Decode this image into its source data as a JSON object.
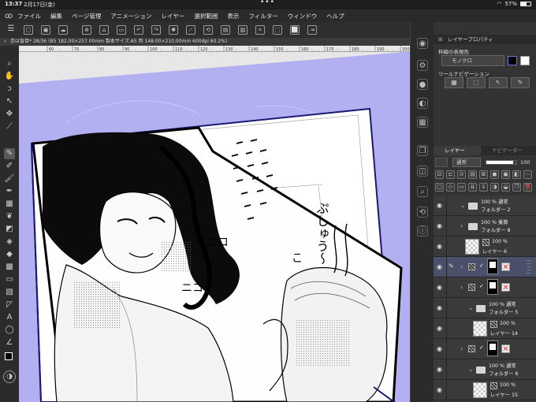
{
  "status": {
    "time": "13:37",
    "date": "2月17日(金)",
    "battery": "57%",
    "battery_level": 0.57
  },
  "menu": {
    "items": [
      "ファイル",
      "編集",
      "ページ管理",
      "アニメーション",
      "レイヤー",
      "選択範囲",
      "表示",
      "フィルター",
      "ウィンドウ",
      "ヘルプ"
    ]
  },
  "document": {
    "tab_title": "恋は盲目* 28/36 (B5 182.00×257.00mm 製本サイズ:A5 判 148.00×210.00mm 600dpi 60.2%)"
  },
  "ruler": {
    "ticks": [
      "60",
      "70",
      "80",
      "90",
      "100",
      "110",
      "120",
      "130",
      "140",
      "150",
      "160",
      "170",
      "180",
      "190",
      "200"
    ]
  },
  "properties": {
    "title": "レイヤープロパティ",
    "effect_label": "枠線の表現色",
    "color_mode": "モノクロ",
    "tool_nav_label": "ツールナビゲーション"
  },
  "layers_panel": {
    "tab_layers": "レイヤー",
    "tab_navigator": "ナビゲーター",
    "blend_mode": "通常",
    "opacity": "100",
    "layers": [
      {
        "line1": "100 % 通常",
        "line2": "フォルダー 2",
        "kind": "folder",
        "indent": 0,
        "expanded": true
      },
      {
        "line1": "100 % 乗算",
        "line2": "フォルダー 8",
        "kind": "folder",
        "indent": 0,
        "expanded": false
      },
      {
        "line1": "100 %",
        "line2": "レイヤー 6",
        "kind": "raster",
        "indent": 0
      },
      {
        "line1": "",
        "line2": "",
        "kind": "selected-folder",
        "indent": 0
      },
      {
        "line1": "",
        "line2": "",
        "kind": "mask-folder",
        "indent": 0
      },
      {
        "line1": "100 % 通常",
        "line2": "フォルダー 5",
        "kind": "folder",
        "indent": 1,
        "expanded": true
      },
      {
        "line1": "100 %",
        "line2": "レイヤー 14",
        "kind": "raster",
        "indent": 1
      },
      {
        "line1": "",
        "line2": "",
        "kind": "mask-folder",
        "indent": 0
      },
      {
        "line1": "100 % 通常",
        "line2": "フォルダー 6",
        "kind": "folder",
        "indent": 1,
        "expanded": true
      },
      {
        "line1": "100 %",
        "line2": "レイヤー 15",
        "kind": "raster",
        "indent": 1
      },
      {
        "line1": "",
        "line2": "",
        "kind": "mask-folder",
        "indent": 0
      }
    ]
  },
  "manga": {
    "sfx_right": "ぷしゅう〜",
    "sfx_a": "ニコ",
    "sfx_b": "ニコ",
    "sfx_c": "こ"
  }
}
